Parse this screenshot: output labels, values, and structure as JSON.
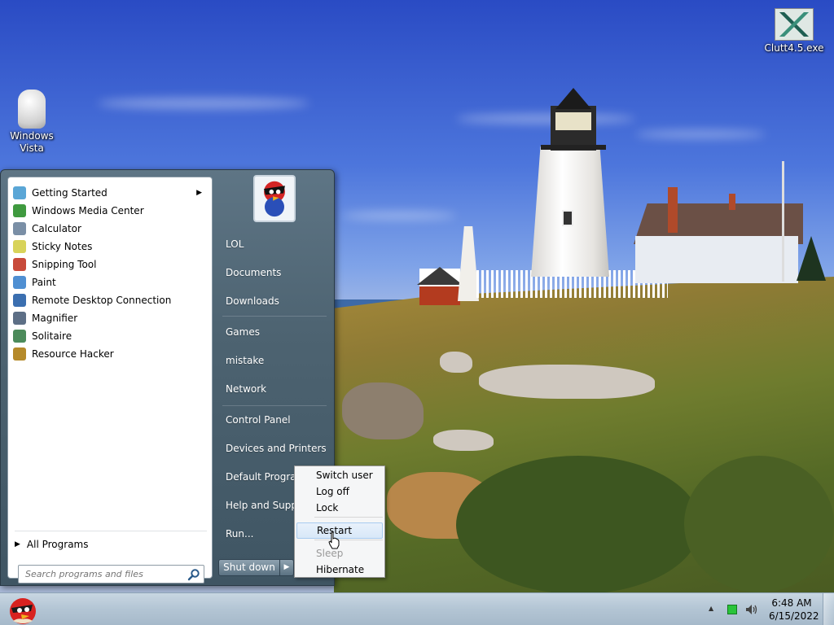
{
  "desktop": {
    "icons": [
      {
        "label": "Windows\nVista"
      },
      {
        "label": "Clutt4.5.exe"
      }
    ]
  },
  "start_menu": {
    "programs": [
      {
        "label": "Getting Started",
        "icon": "getting-started-icon",
        "color": "#5aa6d6",
        "has_submenu": true
      },
      {
        "label": "Windows Media Center",
        "icon": "media-center-icon",
        "color": "#3f9a3f"
      },
      {
        "label": "Calculator",
        "icon": "calculator-icon",
        "color": "#7a8fa6"
      },
      {
        "label": "Sticky Notes",
        "icon": "sticky-notes-icon",
        "color": "#d8d35a"
      },
      {
        "label": "Snipping Tool",
        "icon": "scissors-icon",
        "color": "#c84a3a"
      },
      {
        "label": "Paint",
        "icon": "paint-icon",
        "color": "#4f8fd2"
      },
      {
        "label": "Remote Desktop Connection",
        "icon": "remote-desktop-icon",
        "color": "#3b6fb0"
      },
      {
        "label": "Magnifier",
        "icon": "magnifier-icon",
        "color": "#5d6f86"
      },
      {
        "label": "Solitaire",
        "icon": "solitaire-icon",
        "color": "#4c8b5b"
      },
      {
        "label": "Resource Hacker",
        "icon": "resource-hacker-icon",
        "color": "#b58a2a"
      }
    ],
    "all_programs": "All Programs",
    "search_placeholder": "Search programs and files",
    "right_items": [
      {
        "label": "LOL",
        "name": "lol"
      },
      {
        "label": "Documents",
        "name": "documents"
      },
      {
        "label": "Downloads",
        "name": "downloads"
      },
      {
        "label": "Games",
        "name": "games"
      },
      {
        "label": "mistake",
        "name": "mistake"
      },
      {
        "label": "Network",
        "name": "network"
      },
      {
        "label": "Control Panel",
        "name": "control-panel"
      },
      {
        "label": "Devices and Printers",
        "name": "devices-and-printers"
      },
      {
        "label": "Default Programs",
        "name": "default-programs"
      },
      {
        "label": "Help and Support",
        "name": "help-and-support"
      },
      {
        "label": "Run...",
        "name": "run"
      }
    ],
    "shutdown_label": "Shut down"
  },
  "shutdown_menu": {
    "items": [
      {
        "label": "Switch user",
        "state": "normal"
      },
      {
        "label": "Log off",
        "state": "normal"
      },
      {
        "label": "Lock",
        "state": "normal"
      },
      {
        "label": "Restart",
        "state": "hover"
      },
      {
        "label": "Sleep",
        "state": "disabled"
      },
      {
        "label": "Hibernate",
        "state": "normal"
      }
    ]
  },
  "taskbar": {
    "time": "6:48 AM",
    "date": "6/15/2022"
  },
  "colors": {
    "accent": "#5e7585",
    "hover_border": "#a8cbef"
  }
}
